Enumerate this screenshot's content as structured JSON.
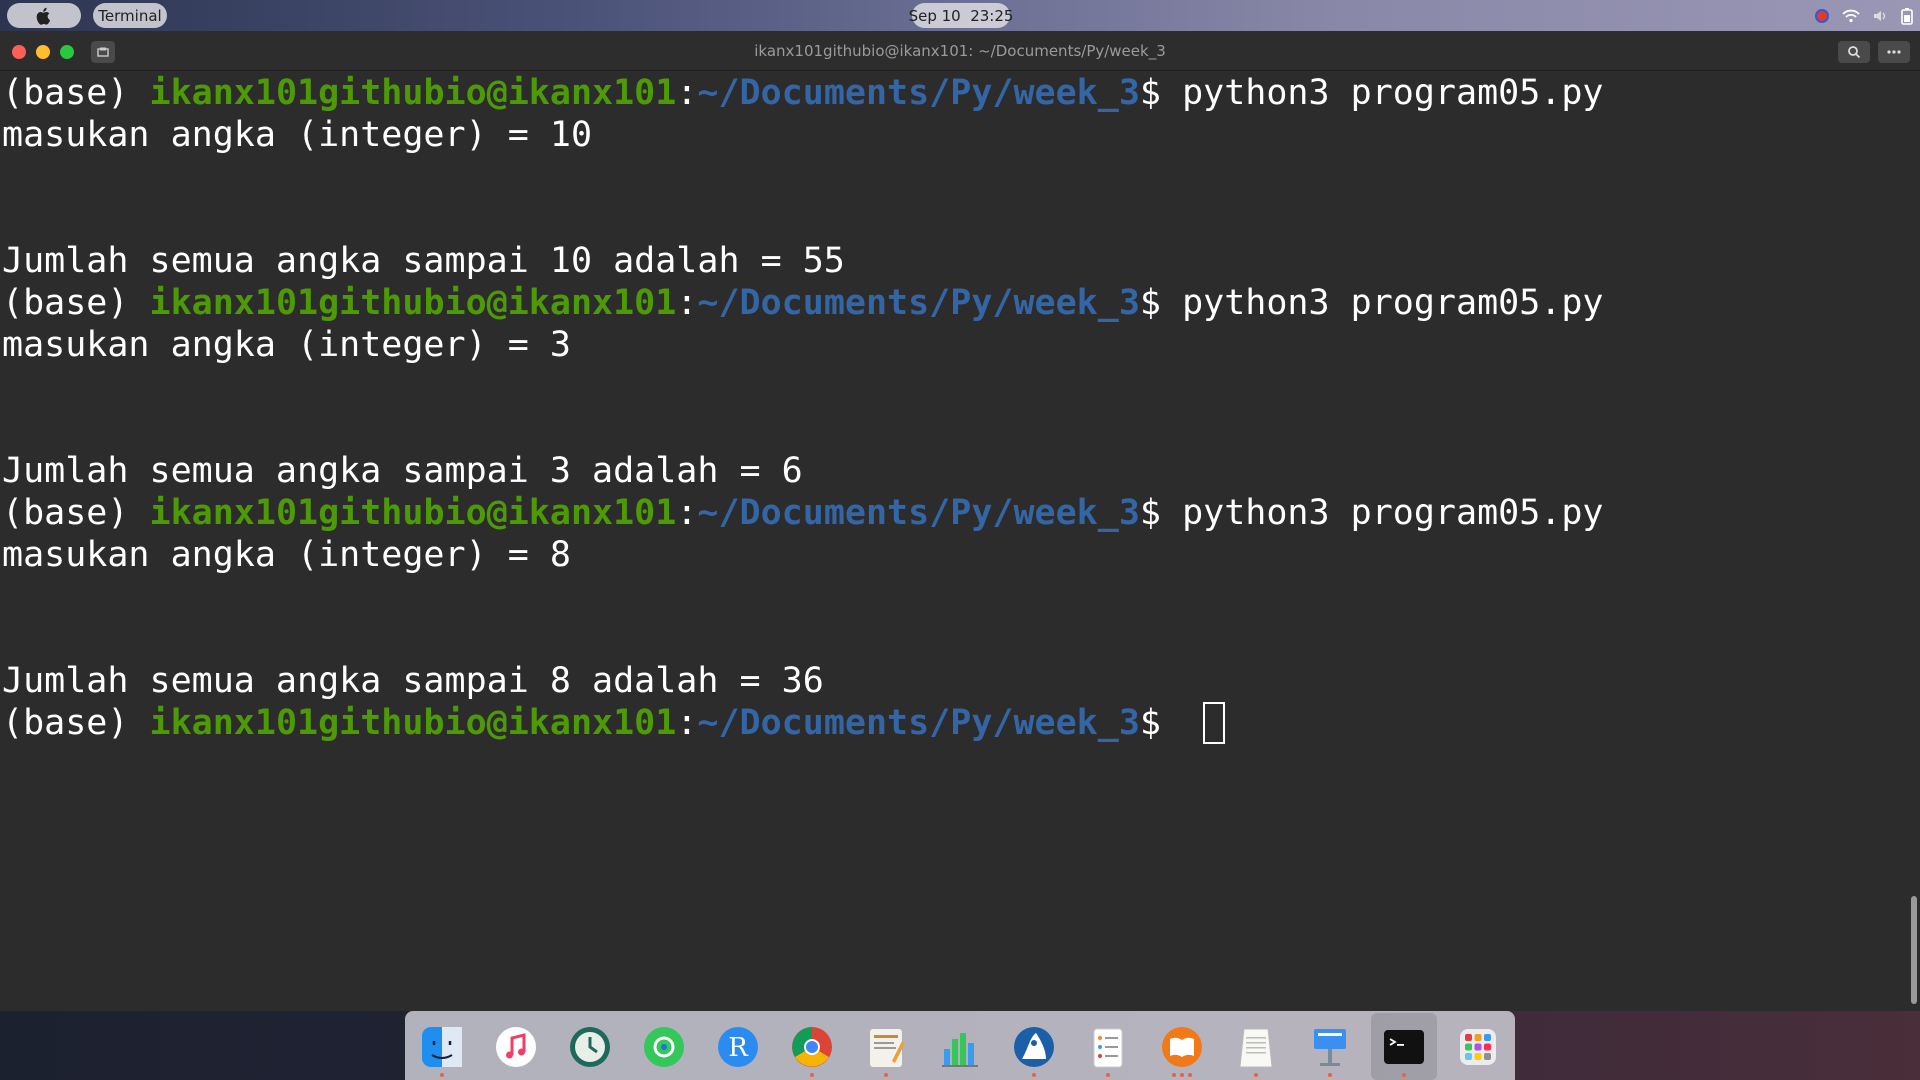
{
  "menubar": {
    "apple_icon": "apple-logo-icon",
    "app_name": "Terminal",
    "clock": "Sep 10  23:25",
    "tray_icons": [
      "chrome-record-icon",
      "wifi-icon",
      "volume-icon",
      "battery-icon"
    ]
  },
  "window": {
    "title": "ikanx101githubio@ikanx101: ~/Documents/Py/week_3",
    "buttons": [
      "search-icon",
      "menu-dots-icon"
    ]
  },
  "terminal": {
    "colors": {
      "userhost": "#4e9a06",
      "path": "#3465a4",
      "text": "#ffffff",
      "background": "#2c2c2c"
    },
    "prompt": {
      "env": "(base) ",
      "userhost": "ikanx101githubio@ikanx101",
      "colon": ":",
      "path": "~/Documents/Py/week_3",
      "dollar": "$ "
    },
    "runs": [
      {
        "command": "python3 program05.py",
        "input_line": "masukan angka (integer) = 10",
        "result_line": "Jumlah semua angka sampai 10 adalah = 55"
      },
      {
        "command": "python3 program05.py",
        "input_line": "masukan angka (integer) = 3",
        "result_line": "Jumlah semua angka sampai 3 adalah = 6"
      },
      {
        "command": "python3 program05.py",
        "input_line": "masukan angka (integer) = 8",
        "result_line": "Jumlah semua angka sampai 8 adalah = 36"
      }
    ]
  },
  "dock": {
    "items": [
      "finder-icon",
      "music-icon",
      "timemachine-icon",
      "findmy-icon",
      "r-language-icon",
      "chrome-icon",
      "pages-icon",
      "numbers-icon",
      "inkscape-icon",
      "reminders-icon",
      "books-icon",
      "textedit-icon",
      "keynote-icon",
      "terminal-icon",
      "launchpad-icon"
    ]
  }
}
